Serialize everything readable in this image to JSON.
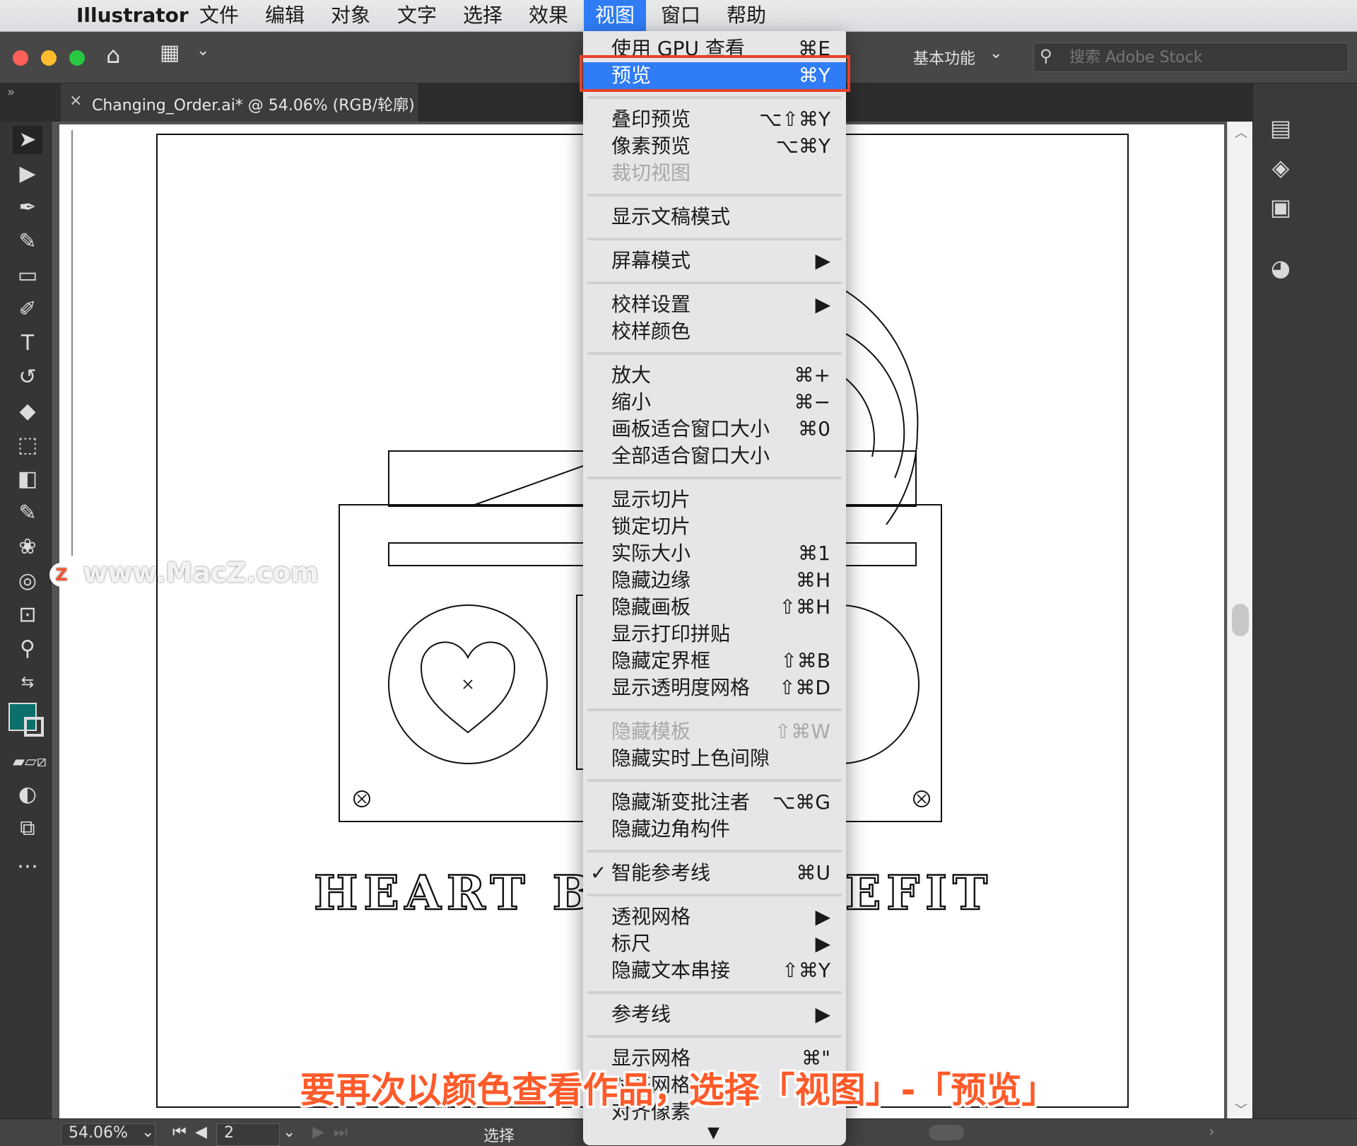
{
  "menubar": {
    "apple_icon": "apple-icon",
    "app_name": "Illustrator",
    "items": [
      "文件",
      "编辑",
      "对象",
      "文字",
      "选择",
      "效果",
      "视图",
      "窗口",
      "帮助"
    ],
    "active_item": "视图"
  },
  "toolbar": {
    "workspace": "基本功能",
    "search_placeholder": "搜索 Adobe Stock",
    "search_icon": "search-icon"
  },
  "document_tab": {
    "close": "×",
    "title": "Changing_Order.ai* @ 54.06% (RGB/轮廓)"
  },
  "view_menu": {
    "items": [
      {
        "label": "使用 GPU 查看",
        "shortcut": "⌘E"
      },
      {
        "label": "预览",
        "shortcut": "⌘Y",
        "highlighted": true
      },
      {
        "label": "叠印预览",
        "shortcut": "⌥⇧⌘Y"
      },
      {
        "label": "像素预览",
        "shortcut": "⌥⌘Y"
      },
      {
        "label": "裁切视图",
        "shortcut": "",
        "disabled": true
      },
      {
        "label": "显示文稿模式",
        "shortcut": ""
      },
      {
        "label": "屏幕模式",
        "shortcut": "▶"
      },
      {
        "label": "校样设置",
        "shortcut": "▶"
      },
      {
        "label": "校样颜色",
        "shortcut": ""
      },
      {
        "label": "放大",
        "shortcut": "⌘+"
      },
      {
        "label": "缩小",
        "shortcut": "⌘−"
      },
      {
        "label": "画板适合窗口大小",
        "shortcut": "⌘0"
      },
      {
        "label": "全部适合窗口大小",
        "shortcut": ""
      },
      {
        "label": "显示切片",
        "shortcut": ""
      },
      {
        "label": "锁定切片",
        "shortcut": ""
      },
      {
        "label": "实际大小",
        "shortcut": "⌘1"
      },
      {
        "label": "隐藏边缘",
        "shortcut": "⌘H"
      },
      {
        "label": "隐藏画板",
        "shortcut": "⇧⌘H"
      },
      {
        "label": "显示打印拼贴",
        "shortcut": ""
      },
      {
        "label": "隐藏定界框",
        "shortcut": "⇧⌘B"
      },
      {
        "label": "显示透明度网格",
        "shortcut": "⇧⌘D"
      },
      {
        "label": "隐藏模板",
        "shortcut": "⇧⌘W",
        "disabled": true
      },
      {
        "label": "隐藏实时上色间隙",
        "shortcut": ""
      },
      {
        "label": "隐藏渐变批注者",
        "shortcut": "⌥⌘G"
      },
      {
        "label": "隐藏边角构件",
        "shortcut": ""
      },
      {
        "label": "智能参考线",
        "shortcut": "⌘U",
        "checked": true
      },
      {
        "label": "透视网格",
        "shortcut": "▶"
      },
      {
        "label": "标尺",
        "shortcut": "▶"
      },
      {
        "label": "隐藏文本串接",
        "shortcut": "⇧⌘Y"
      },
      {
        "label": "参考线",
        "shortcut": "▶"
      },
      {
        "label": "显示网格",
        "shortcut": "⌘\""
      },
      {
        "label": "对齐网格",
        "shortcut": ""
      },
      {
        "label": "对齐像素",
        "shortcut": ""
      }
    ],
    "check_mark": "✓",
    "more_arrow": "▼"
  },
  "artwork": {
    "headline_left": "HEART BE",
    "headline_right": "EFIT"
  },
  "status": {
    "zoom": "54.06%",
    "page": "2",
    "tool": "选择"
  },
  "watermark": "www.MacZ.com",
  "caption": "要再次以颜色查看作品，选择「视图」-「预览」",
  "colors": {
    "fill_swatch": "#0b6f6c",
    "menu_highlight": "#2f7cf6",
    "callout_border": "#e8402c",
    "caption_text": "#ff5a2a"
  }
}
